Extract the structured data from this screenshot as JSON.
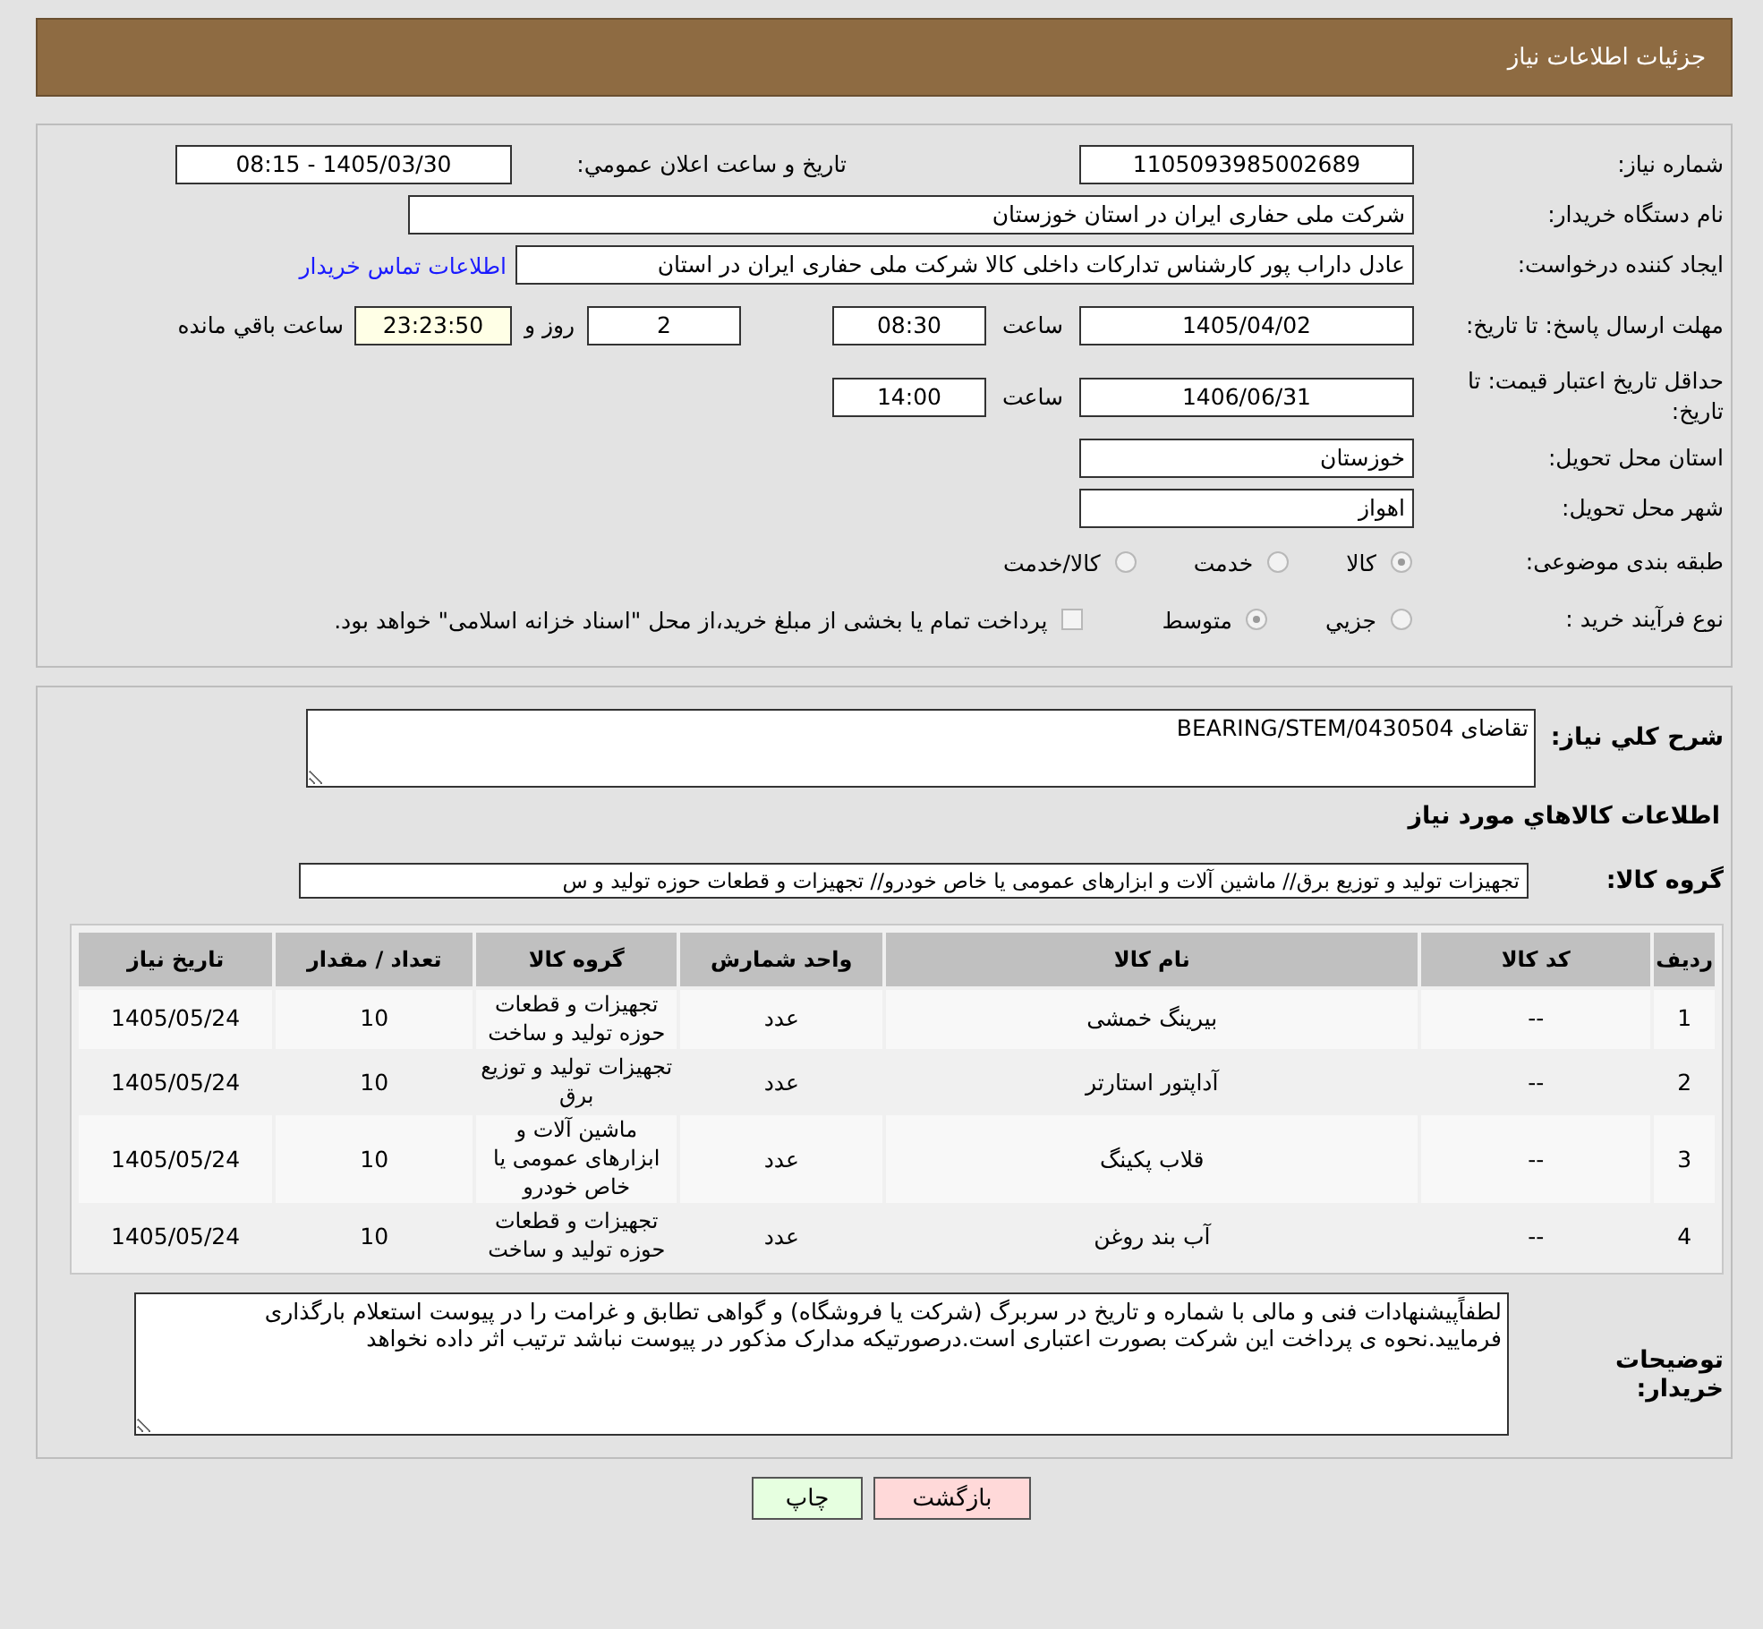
{
  "header": {
    "title": "جزئیات اطلاعات نیاز"
  },
  "details": {
    "need_number": {
      "label": "شماره نیاز:",
      "value": "1105093985002689"
    },
    "announce": {
      "label": "تاريخ و ساعت اعلان عمومي:",
      "value": "1405/03/30 - 08:15"
    },
    "buyer_org": {
      "label": "نام دستگاه خريدار:",
      "value": "شرکت ملی حفاری ایران در استان خوزستان"
    },
    "requester": {
      "label": "ايجاد کننده درخواست:",
      "value": "عادل داراب پور کارشناس تدارکات داخلی کالا شرکت ملی حفاری ایران در استان",
      "link": "اطلاعات تماس خریدار"
    },
    "deadline": {
      "label": "مهلت ارسال پاسخ: تا تاریخ:",
      "date": "1405/04/02",
      "time_label": "ساعت",
      "time": "08:30",
      "days": "2",
      "days_label": "روز و",
      "remaining": "23:23:50",
      "remaining_label": "ساعت باقي مانده"
    },
    "validity": {
      "label": "حداقل تاریخ اعتبار قیمت: تا تاریخ:",
      "date": "1406/06/31",
      "time_label": "ساعت",
      "time": "14:00"
    },
    "province": {
      "label": "استان محل تحویل:",
      "value": "خوزستان"
    },
    "city": {
      "label": "شهر محل تحویل:",
      "value": "اهواز"
    },
    "category": {
      "label": "طبقه بندی موضوعی:",
      "options": [
        {
          "label": "کالا",
          "selected": true
        },
        {
          "label": "خدمت",
          "selected": false
        },
        {
          "label": "کالا/خدمت",
          "selected": false
        }
      ]
    },
    "process": {
      "label": "نوع فرآیند خرید :",
      "options": [
        {
          "label": "جزيي",
          "selected": false
        },
        {
          "label": "متوسط",
          "selected": true
        }
      ],
      "payment": {
        "checked": false,
        "label": "پرداخت تمام یا بخشی از مبلغ خرید،از محل \"اسناد خزانه اسلامی\" خواهد بود."
      }
    }
  },
  "goods": {
    "description": {
      "label": "شرح کلي نياز:",
      "value": "تقاضای BEARING/STEM/0430504"
    },
    "heading": "اطلاعات کالاهاي مورد نياز",
    "group": {
      "label": "گروه کالا:",
      "value": "تجهیزات تولید و توزیع برق//  ماشین آلات و ابزارهای عمومی یا خاص خودرو// تجهیزات و قطعات حوزه تولید و س"
    },
    "table": {
      "columns": [
        "ردیف",
        "کد کالا",
        "نام کالا",
        "واحد شمارش",
        "گروه کالا",
        "تعداد / مقدار",
        "تاریخ نیاز"
      ],
      "rows": [
        [
          "1",
          "--",
          "بیرینگ خمشی",
          "عدد",
          "تجهیزات و قطعات حوزه تولید و ساخت",
          "10",
          "1405/05/24"
        ],
        [
          "2",
          "--",
          "آداپتور استارتر",
          "عدد",
          "تجهیزات تولید و توزیع برق",
          "10",
          "1405/05/24"
        ],
        [
          "3",
          "--",
          "قلاب پکینگ",
          "عدد",
          "ماشین آلات و ابزارهای عمومی یا خاص خودرو",
          "10",
          "1405/05/24"
        ],
        [
          "4",
          "--",
          "آب بند روغن",
          "عدد",
          "تجهیزات و قطعات حوزه تولید و ساخت",
          "10",
          "1405/05/24"
        ]
      ]
    },
    "buyer_notes": {
      "label": "توضیحات خریدار:",
      "value": "لطفاًپیشنهادات فنی و مالی با شماره و تاریخ در سربرگ (شرکت یا فروشگاه) و گواهی تطابق و غرامت را در پیوست استعلام بارگذاری فرمایید.نحوه ی پرداخت این شرکت بصورت اعتباری است.درصورتیکه مدارک مذکور در پیوست نباشد ترتیب اثر داده نخواهد"
    }
  },
  "buttons": [
    {
      "kind": "back",
      "label": "بازگشت"
    },
    {
      "kind": "print",
      "label": "چاپ"
    }
  ]
}
